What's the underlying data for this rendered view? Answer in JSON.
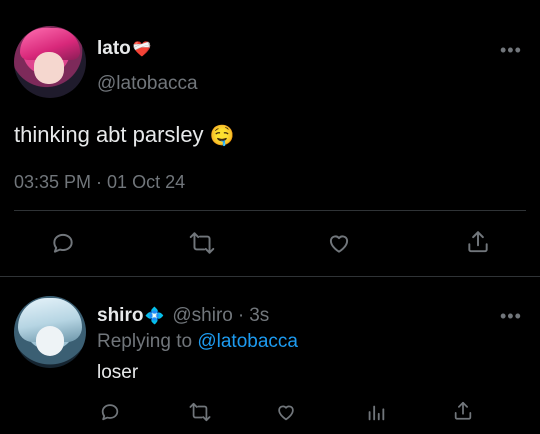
{
  "main_tweet": {
    "author_name": "lato",
    "author_badge_emoji": "❤️‍🩹",
    "handle": "@latobacca",
    "text": "thinking abt parsley",
    "text_emoji": "🤤",
    "timestamp": "03:35 PM · 01 Oct 24",
    "more_label": "•••",
    "actions": [
      "reply-icon",
      "retweet-icon",
      "like-icon",
      "share-icon"
    ]
  },
  "reply": {
    "author_name": "shiro",
    "author_badge_emoji": "💠",
    "handle": "@shiro",
    "separator": "·",
    "age": "3s",
    "replying_to_prefix": "Replying to ",
    "replying_to_handle": "@latobacca",
    "text": "loser",
    "more_label": "•••",
    "actions": [
      "reply-icon",
      "retweet-icon",
      "like-icon",
      "analytics-icon",
      "share-icon"
    ]
  },
  "colors": {
    "background": "#000000",
    "text": "#e7e9ea",
    "muted": "#71767b",
    "link": "#1d9bf0",
    "divider": "#2f3336"
  }
}
